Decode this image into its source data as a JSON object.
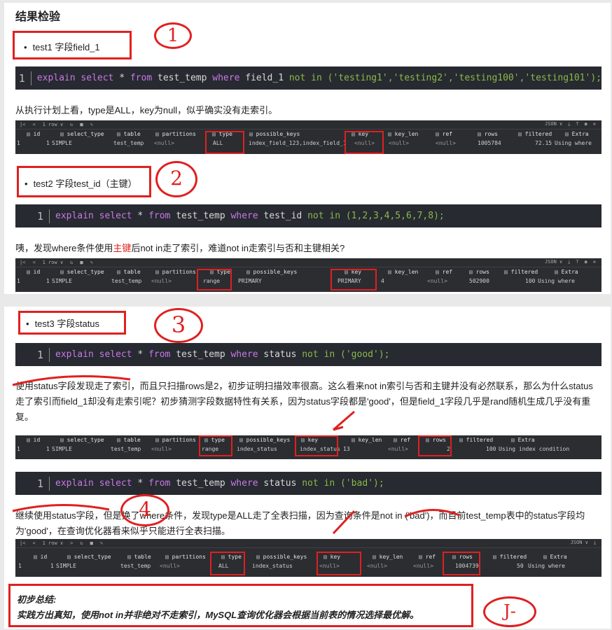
{
  "section1": {
    "title": "结果检验",
    "test1_label": "test1 字段field_1",
    "test1_sql": {
      "line": "1",
      "kw1": "explain select",
      "star": " * ",
      "kw2": "from",
      "tbl": " test_temp ",
      "kw3": "where",
      "col": " field_1 ",
      "op": "not in",
      "val": " ('testing1','testing2','testing100','testing101');"
    },
    "test1_desc": "从执行计划上看，type是ALL，key为null，似乎确实没有走索引。",
    "grid1": {
      "toolbar_rows": "1 row ∨",
      "json": "JSON ∨",
      "headers": [
        "id",
        "select_type",
        "table",
        "partitions",
        "type",
        "possible_keys",
        "key",
        "key_len",
        "ref",
        "rows",
        "filtered",
        "Extra"
      ],
      "cells": {
        "rownum": "1",
        "id": "1",
        "select_type": "SIMPLE",
        "table": "test_temp",
        "partitions": "<null>",
        "type": "ALL",
        "possible_keys": "index_field_123,index_field_1",
        "key": "<null>",
        "key_len": "<null>",
        "ref": "<null>",
        "rows": "1005784",
        "filtered": "72.15",
        "extra": "Using where"
      }
    },
    "test2_label": "test2 字段test_id（主键）",
    "test2_sql": {
      "line": "1",
      "kw1": "explain select",
      "star": " * ",
      "kw2": "from",
      "tbl": " test_temp ",
      "kw3": "where",
      "col": " test_id ",
      "op": "not in",
      "val": " (1,2,3,4,5,6,7,8);"
    },
    "test2_desc_pre": "咦，发现where条件使用",
    "test2_desc_link": "主键",
    "test2_desc_post": "后not in走了索引，难道not in走索引与否和主键相关?",
    "grid2": {
      "toolbar_rows": "1 row ∨",
      "json": "JSON ∨",
      "headers": [
        "id",
        "select_type",
        "table",
        "partitions",
        "type",
        "possible_keys",
        "key",
        "key_len",
        "ref",
        "rows",
        "filtered",
        "Extra"
      ],
      "cells": {
        "rownum": "1",
        "id": "1",
        "select_type": "SIMPLE",
        "table": "test_temp",
        "partitions": "<null>",
        "type": "range",
        "possible_keys": "PRIMARY",
        "key": "PRIMARY",
        "key_len": "4",
        "ref": "<null>",
        "rows": "502900",
        "filtered": "100",
        "extra": "Using where"
      }
    },
    "circle1": "1",
    "circle2": "2"
  },
  "section2": {
    "test3_label": "test3 字段status",
    "test3_sql": {
      "line": "1",
      "kw1": "explain select",
      "star": " * ",
      "kw2": "from",
      "tbl": " test_temp ",
      "kw3": "where",
      "col": " status ",
      "op": "not in",
      "val": " ('good');"
    },
    "test3_desc": "使用status字段发现走了索引，而且只扫描rows是2，初步证明扫描效率很高。这么看来not in索引与否和主键并没有必然联系，那么为什么status走了索引而field_1却没有走索引呢？初步猜测字段数据特性有关系，因为status字段都是'good'，但是field_1字段几乎是rand随机生成几乎没有重复。",
    "grid3": {
      "headers": [
        "id",
        "select_type",
        "table",
        "partitions",
        "type",
        "possible_keys",
        "key",
        "key_len",
        "ref",
        "rows",
        "filtered",
        "Extra"
      ],
      "cells": {
        "rownum": "1",
        "id": "1",
        "select_type": "SIMPLE",
        "table": "test_temp",
        "partitions": "<null>",
        "type": "range",
        "possible_keys": "index_status",
        "key": "index_status",
        "key_len": "13",
        "ref": "<null>",
        "rows": "2",
        "filtered": "100",
        "extra": "Using index condition"
      }
    },
    "test4_sql": {
      "line": "1",
      "kw1": "explain select",
      "star": " * ",
      "kw2": "from",
      "tbl": " test_temp ",
      "kw3": "where",
      "col": " status ",
      "op": "not in",
      "val": " ('bad');"
    },
    "test4_desc": "继续使用status字段，但是换了where条件，发现type是ALL走了全表扫描，因为查询条件是not in ('bad')，而目前test_temp表中的status字段均为'good'，在查询优化器看来似乎只能进行全表扫描。",
    "grid4": {
      "toolbar_rows": "1 row ∨",
      "json": "JSON ∨",
      "headers": [
        "id",
        "select_type",
        "table",
        "partitions",
        "type",
        "possible_keys",
        "key",
        "key_len",
        "ref",
        "rows",
        "filtered",
        "Extra"
      ],
      "cells": {
        "rownum": "1",
        "id": "1",
        "select_type": "SIMPLE",
        "table": "test_temp",
        "partitions": "<null>",
        "type": "ALL",
        "possible_keys": "index_status",
        "key": "<null>",
        "key_len": "<null>",
        "ref": "<null>",
        "rows": "1004739",
        "filtered": "50",
        "extra": "Using where"
      }
    },
    "summary_title": "初步总结:",
    "summary_text": "实践方出真知，使用not in并非绝对不走索引，MySQL查询优化器会根据当前表的情况选择最优解。",
    "circle3": "3",
    "circle4": "4",
    "circle5": "J-"
  },
  "colors": {
    "annotation_red": "#e02020",
    "code_bg": "#272a30",
    "keyword": "#c878e8",
    "string": "#8ab94a"
  }
}
